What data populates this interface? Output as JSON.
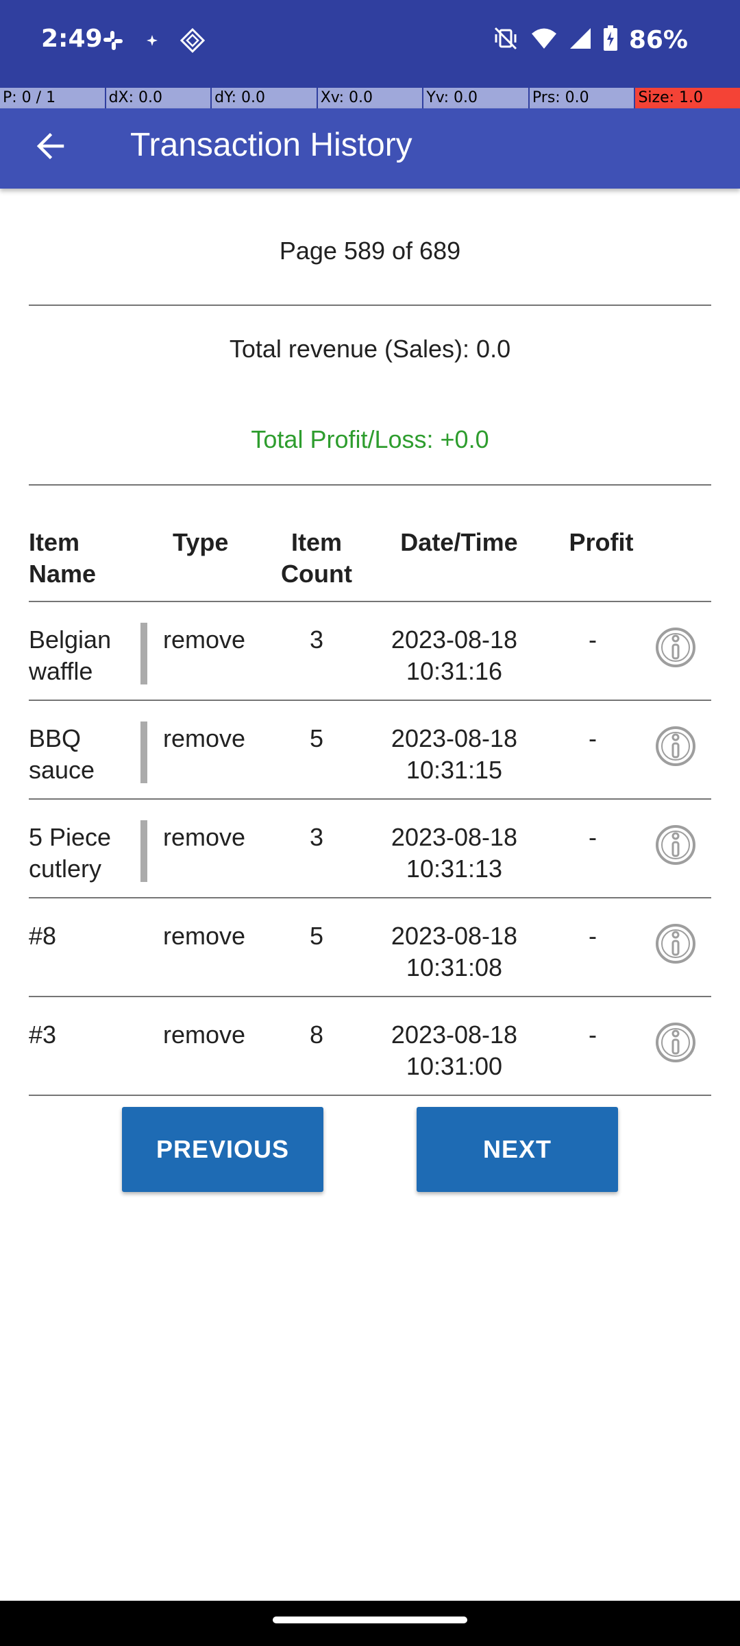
{
  "status_bar": {
    "time": "2:49",
    "battery_percent": "86%",
    "left_icons": [
      "slack-icon",
      "sparkle-icon",
      "diamond-icon"
    ],
    "right_icons": [
      "mute-vibrate-icon",
      "wifi-icon",
      "cell-signal-icon",
      "battery-charging-icon"
    ]
  },
  "debug": {
    "p": "P: 0 / 1",
    "dx": "dX: 0.0",
    "dy": "dY: 0.0",
    "xv": "Xv: 0.0",
    "yv": "Yv: 0.0",
    "prs": "Prs: 0.0",
    "size": "Size: 1.0"
  },
  "app_bar": {
    "title": "Transaction History"
  },
  "summary": {
    "page": "Page 589 of 689",
    "revenue": "Total revenue (Sales): 0.0",
    "profit": "Total Profit/Loss: +0.0"
  },
  "table": {
    "headers": {
      "item_name_1": "Item",
      "item_name_2": "Name",
      "type": "Type",
      "count_1": "Item",
      "count_2": "Count",
      "datetime": "Date/Time",
      "profit": "Profit"
    },
    "rows": [
      {
        "name_1": "Belgian",
        "name_2": "waffle",
        "type": "remove",
        "count": "3",
        "date": "2023-08-18",
        "time": "10:31:16",
        "profit": "-"
      },
      {
        "name_1": "BBQ",
        "name_2": "sauce",
        "type": "remove",
        "count": "5",
        "date": "2023-08-18",
        "time": "10:31:15",
        "profit": "-"
      },
      {
        "name_1": "5 Piece",
        "name_2": "cutlery",
        "type": "remove",
        "count": "3",
        "date": "2023-08-18",
        "time": "10:31:13",
        "profit": "-"
      },
      {
        "name_1": "#8",
        "name_2": "",
        "type": "remove",
        "count": "5",
        "date": "2023-08-18",
        "time": "10:31:08",
        "profit": "-"
      },
      {
        "name_1": "#3",
        "name_2": "",
        "type": "remove",
        "count": "8",
        "date": "2023-08-18",
        "time": "10:31:00",
        "profit": "-"
      }
    ]
  },
  "buttons": {
    "previous": "PREVIOUS",
    "next": "NEXT"
  },
  "colors": {
    "status_bar": "#303F9F",
    "app_bar": "#3F51B5",
    "button": "#1E6BB4",
    "profit_text": "#2E9D2E"
  }
}
